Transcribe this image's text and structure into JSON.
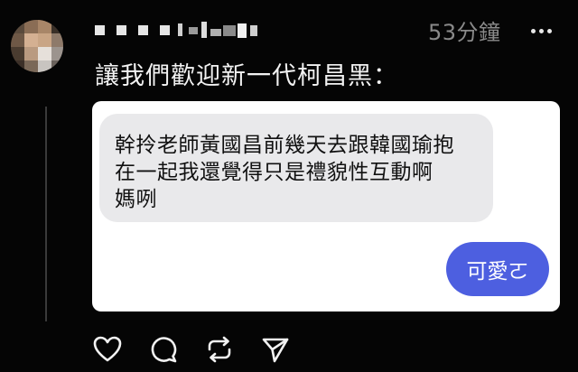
{
  "post": {
    "username_display": "█ █ █ █",
    "timestamp": "53分鐘",
    "caption": "讓我們歡迎新一代柯昌黑：",
    "avatar_icon": "blurred-avatar",
    "more_icon": "more-dots-icon"
  },
  "screenshot_card": {
    "message_lines": [
      "幹拎老師黃國昌前幾天去跟韓國瑜抱",
      "在一起我還覺得只是禮貌性互動啊",
      "媽咧"
    ],
    "reply": "可愛ㄛ",
    "reply_color": "#4d5fe0"
  },
  "actions": [
    {
      "name": "like",
      "icon": "heart-icon"
    },
    {
      "name": "comment",
      "icon": "comment-icon"
    },
    {
      "name": "repost",
      "icon": "repost-icon"
    },
    {
      "name": "share",
      "icon": "send-icon"
    }
  ]
}
